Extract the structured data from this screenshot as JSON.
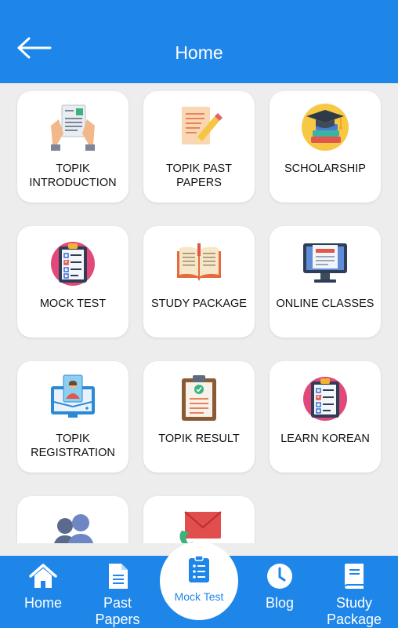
{
  "appbar": {
    "title": "Home",
    "back_icon": "arrow-left-icon"
  },
  "cards": [
    {
      "id": "topik-introduction",
      "line1": "TOPIK",
      "line2": "INTRODUCTION",
      "icon": "document-hands-icon"
    },
    {
      "id": "topik-past-papers",
      "line1": "TOPIK PAST",
      "line2": "PAPERS",
      "icon": "paper-pencil-icon"
    },
    {
      "id": "scholarship",
      "line1": "SCHOLARSHIP",
      "line2": "",
      "icon": "graduation-cap-icon"
    },
    {
      "id": "mock-test",
      "line1": "MOCK TEST",
      "line2": "",
      "icon": "checklist-clipboard-icon"
    },
    {
      "id": "study-package",
      "line1": "STUDY PACKAGE",
      "line2": "",
      "icon": "open-book-icon"
    },
    {
      "id": "online-classes",
      "line1": "ONLINE CLASSES",
      "line2": "",
      "icon": "monitor-icon"
    },
    {
      "id": "topik-registration",
      "line1": "TOPIK",
      "line2": "REGISTRATION",
      "icon": "monitor-user-icon"
    },
    {
      "id": "topik-result",
      "line1": "TOPIK RESULT",
      "line2": "",
      "icon": "clipboard-check-icon"
    },
    {
      "id": "learn-korean",
      "line1": "LEARN KOREAN",
      "line2": "",
      "icon": "checklist-clipboard-icon"
    },
    {
      "id": "partial-1",
      "line1": "",
      "line2": "",
      "icon": "people-icon"
    },
    {
      "id": "partial-2",
      "line1": "",
      "line2": "",
      "icon": "phone-mail-icon"
    }
  ],
  "bottom_nav": [
    {
      "label1": "Home",
      "label2": "",
      "icon": "home-icon"
    },
    {
      "label1": "Past",
      "label2": "Papers",
      "icon": "document-icon"
    },
    {
      "label1": "Blog",
      "label2": "",
      "icon": "clock-icon"
    },
    {
      "label1": "Study",
      "label2": "Package",
      "icon": "book-icon"
    }
  ],
  "fab": {
    "label": "Mock Test",
    "icon": "clipboard-list-icon"
  },
  "colors": {
    "primary": "#1e86e8",
    "background": "#ededed",
    "card": "#ffffff"
  }
}
